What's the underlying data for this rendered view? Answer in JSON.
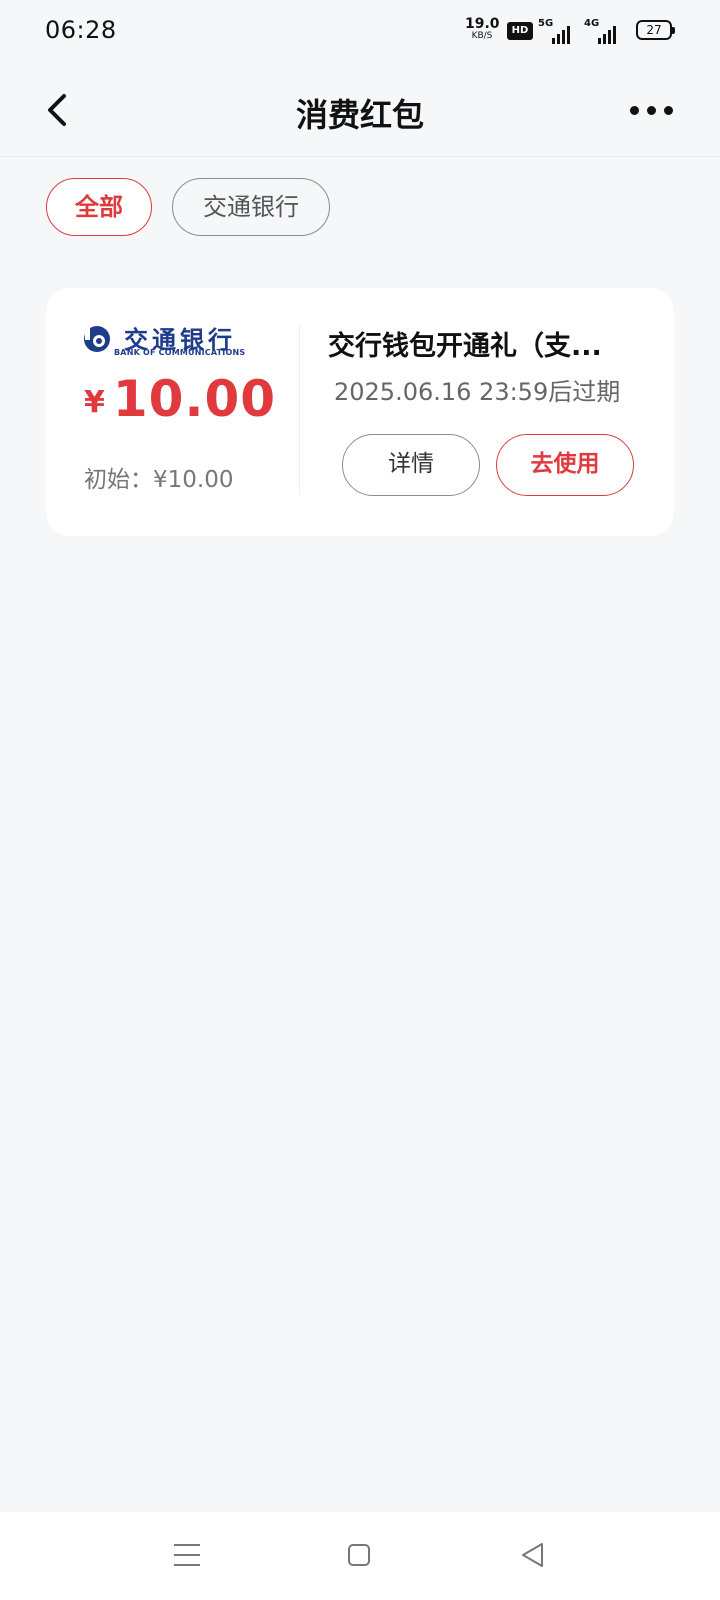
{
  "status_bar": {
    "time": "06:28",
    "net_speed_value": "19.0",
    "net_speed_unit": "KB/S",
    "hd_label": "HD",
    "sim1_label": "5G",
    "sim2_label": "4G",
    "battery": "27"
  },
  "header": {
    "title": "消费红包",
    "back_icon": "chevron-left-icon",
    "more_icon": "more-horizontal-icon"
  },
  "filters": [
    {
      "label": "全部",
      "selected": true
    },
    {
      "label": "交通银行",
      "selected": false
    }
  ],
  "coupons": [
    {
      "bank_logo_cn": "交通银行",
      "bank_logo_en": "BANK OF COMMUNICATIONS",
      "currency_symbol": "¥",
      "amount": "10.00",
      "initial": "初始：¥10.00",
      "name": "交行钱包开通礼（支...",
      "expire": "2025.06.16 23:59后过期",
      "detail_label": "详情",
      "use_label": "去使用"
    }
  ],
  "nav": {
    "menu_icon": "menu-icon",
    "home_icon": "square-home-icon",
    "back_icon": "triangle-back-icon"
  },
  "colors": {
    "accent": "#e03a3e",
    "bank_blue": "#1f3c8a",
    "background": "#f6f7f9"
  }
}
